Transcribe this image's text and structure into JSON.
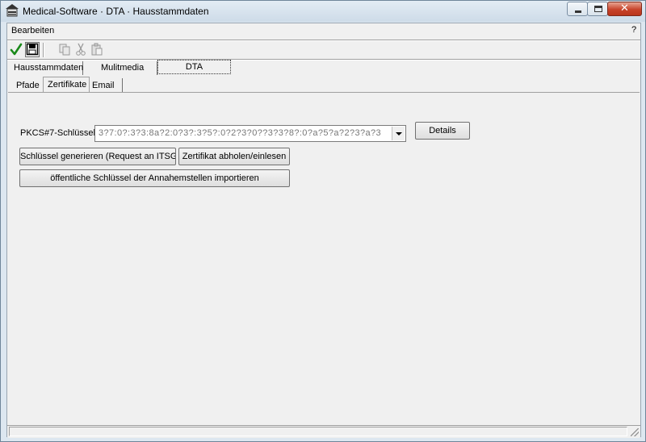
{
  "window": {
    "title": "Medical-Software · DTA · Hausstammdaten",
    "minimize_icon": "minimize-icon",
    "maximize_icon": "maximize-icon",
    "close_icon": "close-icon"
  },
  "menu": {
    "edit": "Bearbeiten",
    "help": "?"
  },
  "toolbar": {
    "items": [
      {
        "icon": "checkmark-icon",
        "enabled": true
      },
      {
        "icon": "save-icon",
        "enabled": true
      },
      {
        "icon": "copy-icon",
        "enabled": false
      },
      {
        "icon": "cut-icon",
        "enabled": false
      },
      {
        "icon": "paste-icon",
        "enabled": false
      }
    ]
  },
  "main_tabs": [
    {
      "label": "Hausstammdaten"
    },
    {
      "label": "Mulitmedia"
    },
    {
      "label": "DTA",
      "active": true
    }
  ],
  "sub_tabs": [
    {
      "label": "Pfade"
    },
    {
      "label": "Zertifikate",
      "active": true
    },
    {
      "label": "Email"
    }
  ],
  "certificates": {
    "pkcs_label": "PKCS#7-Schlüssel",
    "pkcs_value": "3?7:0?:3?3:8a?2:0?3?:3?5?:0?2?3?0??3?3?8?:0?a?5?a?2?3?a?3",
    "details_button": "Details",
    "generate_button": "Schlüssel generieren (Request an ITSG)",
    "fetch_button": "Zertifikat abholen/einlesen",
    "import_button": "öffentliche Schlüssel der Annahemstellen importieren"
  },
  "colors": {
    "accent_check": "#1a8a1a",
    "window_frame": "#dde7f0",
    "close_button": "#c7432a"
  }
}
